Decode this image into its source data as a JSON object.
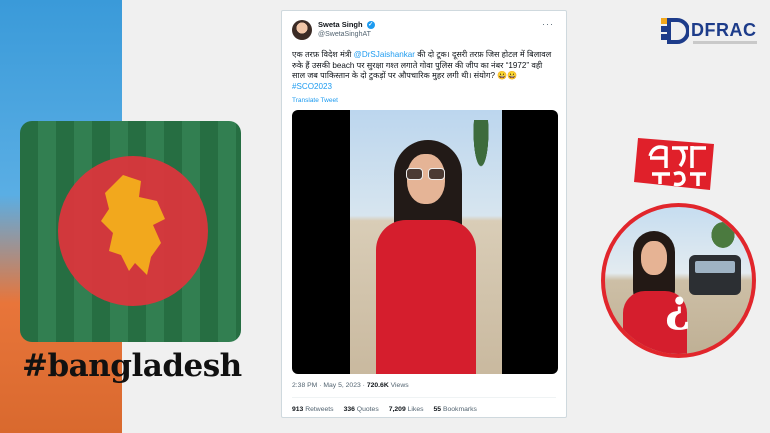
{
  "hashtag": "#bangladesh",
  "tweet": {
    "author_name": "Sweta Singh",
    "author_handle": "@SwetaSinghAT",
    "text_part1": "एक तरफ़ विदेश मंत्री ",
    "mention": "@DrSJaishankar",
    "text_part2": " की दो टूक। दूसरी तरफ़ जिस होटल में बिलावल रुके हैं उसकी beach पर सुरक्षा गश्त लगाते गोवा पुलिस की जीप का नंबर “1972” वही साल जब पाकिस्तान के दो टुकड़ों पर औपचारिक मुहर लगी थी। संयोग? 😀😀 ",
    "hashtag": "#SCO2023",
    "translate_label": "Translate Tweet",
    "time": "2:38 PM · May 5, 2023 · ",
    "views_count": "720.6K",
    "views_label": " Views",
    "retweets_count": "913",
    "retweets_label": " Retweets",
    "quotes_count": "336",
    "quotes_label": " Quotes",
    "likes_count": "7,209",
    "likes_label": " Likes",
    "bookmarks_count": "55",
    "bookmarks_label": " Bookmarks"
  },
  "logos": {
    "dfrac": "DFRAC"
  },
  "icons": {
    "verified": "verified-badge-icon",
    "more": "more-options-icon"
  },
  "colors": {
    "accent_red": "#e1262c",
    "twitter_blue": "#1d9bf0"
  }
}
